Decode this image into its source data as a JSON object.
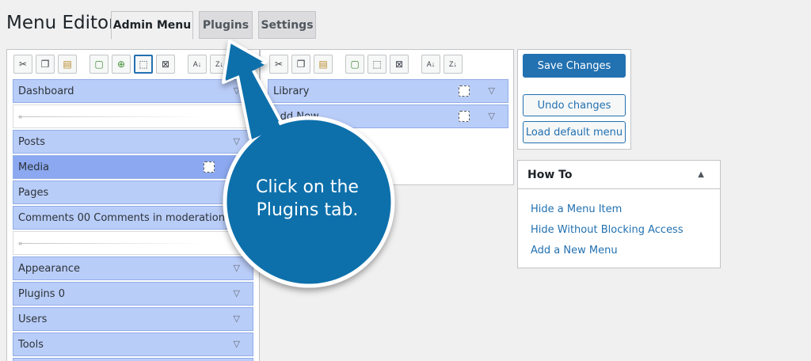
{
  "page": {
    "title": "Menu Editor"
  },
  "tabs": [
    {
      "label": "Admin Menu",
      "active": true
    },
    {
      "label": "Plugins",
      "active": false
    },
    {
      "label": "Settings",
      "active": false
    }
  ],
  "toolbar": {
    "icons": [
      "cut-icon",
      "copy-icon",
      "paste-icon",
      "new-item-icon",
      "new-separator-icon",
      "hide-icon",
      "delete-icon",
      "sort-asc-icon",
      "sort-desc-icon"
    ],
    "glyphs": [
      "✂",
      "❐",
      "📋",
      "+",
      "+",
      "⬚",
      "✕",
      "AZ",
      "ZA"
    ]
  },
  "left_menu": {
    "items": [
      {
        "label": "Dashboard",
        "type": "item"
      },
      {
        "label": "",
        "type": "separator"
      },
      {
        "label": "Posts",
        "type": "item"
      },
      {
        "label": "Media",
        "type": "item",
        "selected": true
      },
      {
        "label": "Pages",
        "type": "item"
      },
      {
        "label": "Comments 00 Comments in moderation",
        "type": "item"
      },
      {
        "label": "",
        "type": "separator"
      },
      {
        "label": "Appearance",
        "type": "item"
      },
      {
        "label": "Plugins 0",
        "type": "item"
      },
      {
        "label": "Users",
        "type": "item"
      },
      {
        "label": "Tools",
        "type": "item"
      }
    ]
  },
  "right_menu": {
    "items": [
      {
        "label": "Library"
      },
      {
        "label": "Add New"
      }
    ]
  },
  "actions": {
    "save": "Save Changes",
    "undo": "Undo changes",
    "load_default": "Load default menu"
  },
  "howto": {
    "title": "How To",
    "links": [
      "Hide a Menu Item",
      "Hide Without Blocking Access",
      "Add a New Menu"
    ]
  },
  "callout": {
    "line1": "Click on the",
    "line2": "Plugins tab."
  },
  "colors": {
    "accent": "#2271b1",
    "callout": "#0d6fab",
    "item_bg": "#b9cdf9"
  }
}
